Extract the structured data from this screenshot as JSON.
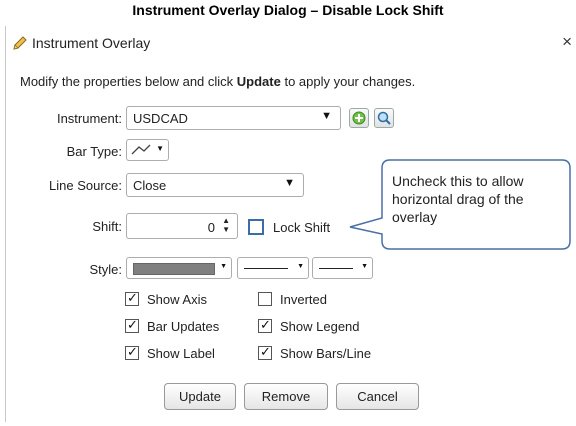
{
  "caption": "Instrument Overlay Dialog – Disable Lock Shift",
  "window": {
    "title": "Instrument Overlay",
    "close_glyph": "×",
    "icon": "pencil-icon"
  },
  "instruction": {
    "pre": "Modify the properties below and click ",
    "bold": "Update",
    "post": " to apply your changes."
  },
  "instrument": {
    "label": "Instrument:",
    "value": "USDCAD",
    "add_icon": "plus-icon",
    "search_icon": "magnifier-icon"
  },
  "bar_type": {
    "label": "Bar Type:",
    "icon": "line-chart-icon"
  },
  "line_source": {
    "label": "Line Source:",
    "value": "Close"
  },
  "shift": {
    "label": "Shift:",
    "value": "0",
    "lock_shift_label": "Lock Shift",
    "lock_shift_checked": false
  },
  "style": {
    "label": "Style:",
    "color": "#808080"
  },
  "checkboxes": {
    "show_axis": {
      "label": "Show Axis",
      "checked": true
    },
    "inverted": {
      "label": "Inverted",
      "checked": false
    },
    "bar_updates": {
      "label": "Bar Updates",
      "checked": true
    },
    "show_legend": {
      "label": "Show Legend",
      "checked": true
    },
    "show_label": {
      "label": "Show Label",
      "checked": true
    },
    "show_bars_line": {
      "label": "Show Bars/Line",
      "checked": true
    }
  },
  "buttons": {
    "update": "Update",
    "remove": "Remove",
    "cancel": "Cancel"
  },
  "callout": {
    "text": "Uncheck this to allow horizontal drag of the overlay",
    "color": "#4a6fa5"
  }
}
